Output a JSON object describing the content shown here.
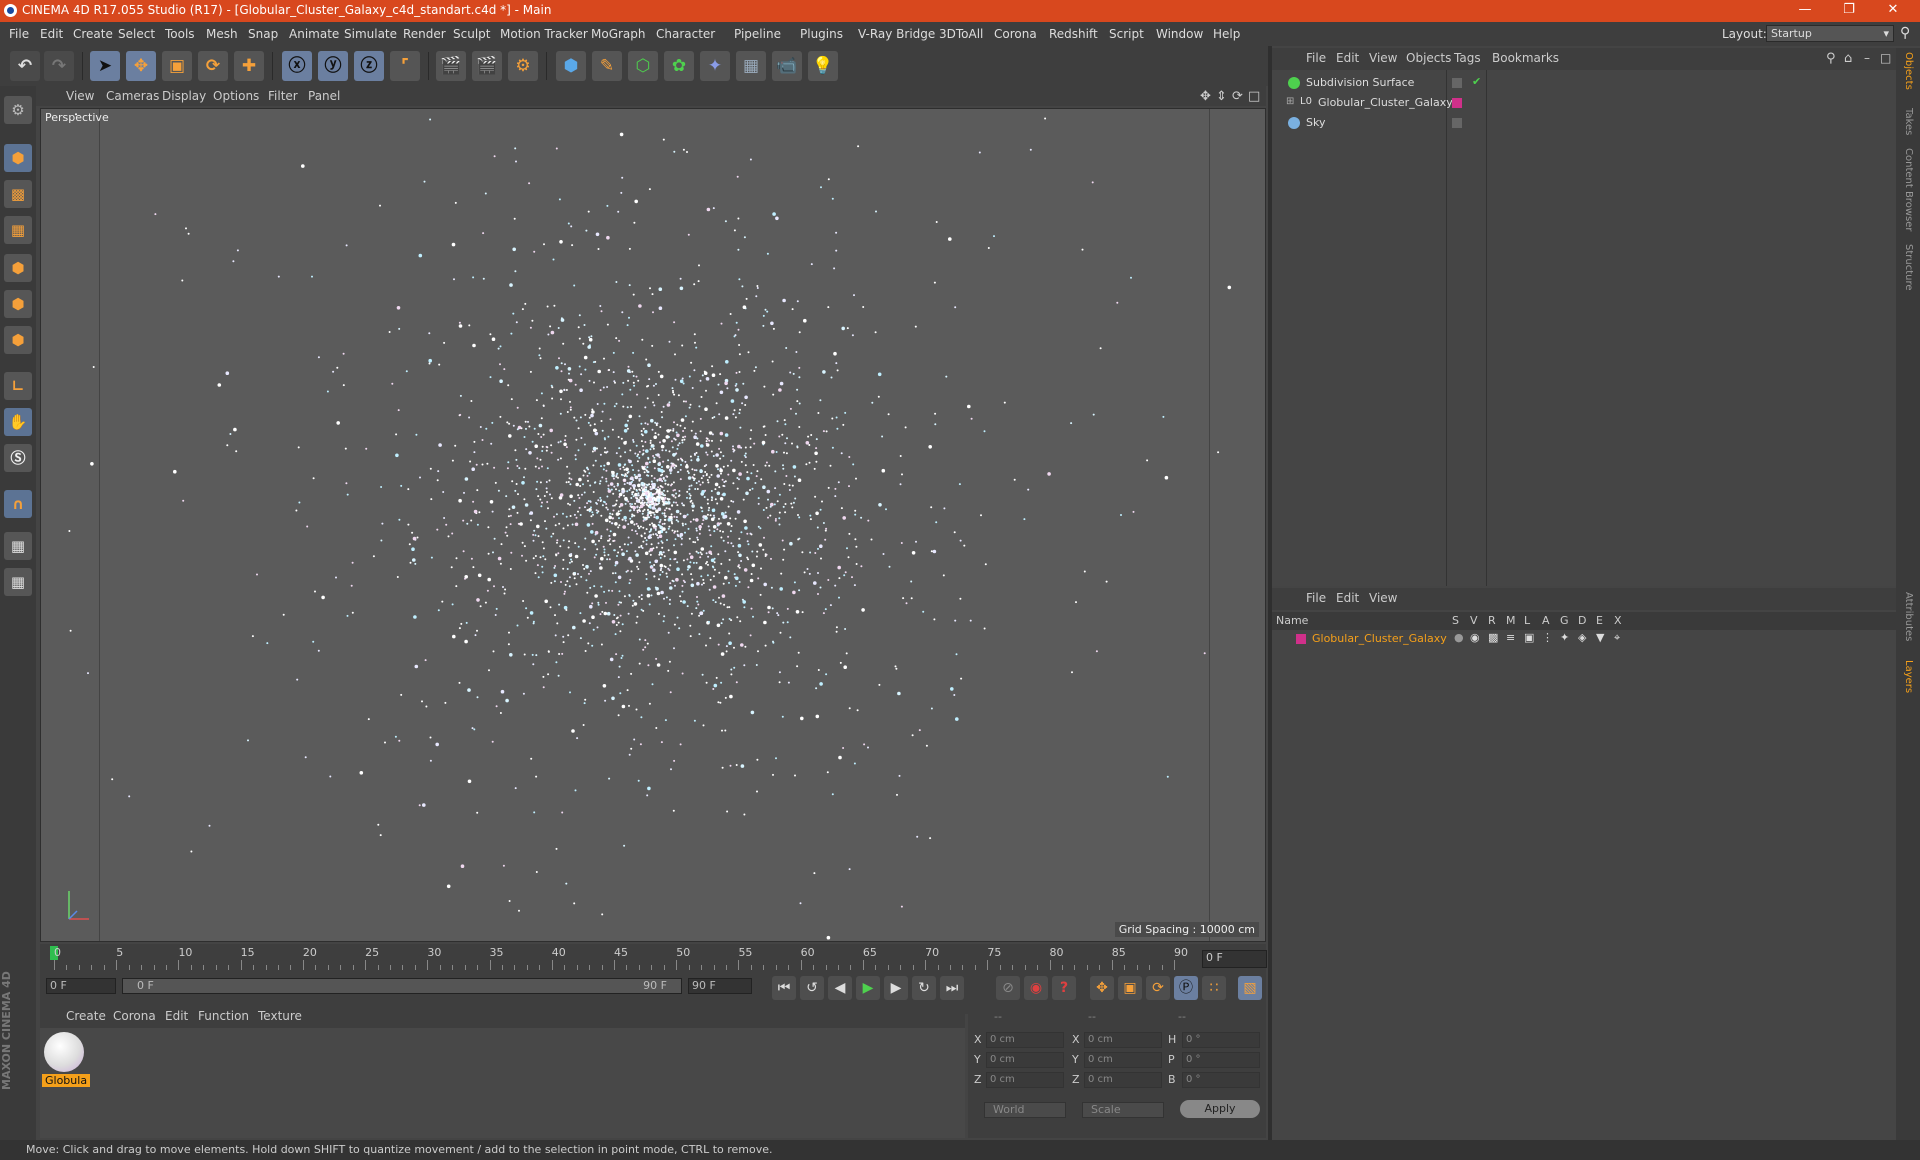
{
  "window": {
    "title": "CINEMA 4D R17.055 Studio (R17) - [Globular_Cluster_Galaxy_c4d_standart.c4d *] - Main",
    "layout_label": "Layout:",
    "layout_value": "Startup"
  },
  "menu": [
    "File",
    "Edit",
    "Create",
    "Select",
    "Tools",
    "Mesh",
    "Snap",
    "Animate",
    "Simulate",
    "Render",
    "Sculpt",
    "Motion Tracker",
    "MoGraph",
    "Character",
    "Pipeline",
    "Plugins",
    "V-Ray Bridge",
    "3DToAll",
    "Corona",
    "Redshift",
    "Script",
    "Window",
    "Help"
  ],
  "viewport": {
    "menu": [
      "View",
      "Cameras",
      "Display",
      "Options",
      "Filter",
      "Panel"
    ],
    "camera_label": "Perspective",
    "grid_spacing": "Grid Spacing : 10000 cm"
  },
  "timeline": {
    "ticks": [
      "0",
      "5",
      "10",
      "15",
      "20",
      "25",
      "30",
      "35",
      "40",
      "45",
      "50",
      "55",
      "60",
      "65",
      "70",
      "75",
      "80",
      "85",
      "90"
    ],
    "current_frame": "0 F",
    "start_field": "0 F",
    "range_start": "0 F",
    "range_end": "90 F",
    "end_field": "90 F"
  },
  "materials": {
    "menu": [
      "Create",
      "Corona",
      "Edit",
      "Function",
      "Texture"
    ],
    "item_name": "Globula"
  },
  "coordinates": {
    "header": [
      "--",
      "--",
      "--"
    ],
    "rows": [
      {
        "l1": "X",
        "v1": "0 cm",
        "l2": "X",
        "v2": "0 cm",
        "l3": "H",
        "v3": "0 °"
      },
      {
        "l1": "Y",
        "v1": "0 cm",
        "l2": "Y",
        "v2": "0 cm",
        "l3": "P",
        "v3": "0 °"
      },
      {
        "l1": "Z",
        "v1": "0 cm",
        "l2": "Z",
        "v2": "0 cm",
        "l3": "B",
        "v3": "0 °"
      }
    ],
    "space": "World",
    "mode": "Scale",
    "apply": "Apply"
  },
  "objects": {
    "menu": [
      "File",
      "Edit",
      "View",
      "Objects",
      "Tags",
      "Bookmarks"
    ],
    "items": [
      "Subdivision Surface",
      "Globular_Cluster_Galaxy",
      "Sky"
    ]
  },
  "layers": {
    "menu": [
      "File",
      "Edit",
      "View"
    ],
    "columns": [
      "Name",
      "S",
      "V",
      "R",
      "M",
      "L",
      "A",
      "G",
      "D",
      "E",
      "X"
    ],
    "items": [
      "Globular_Cluster_Galaxy"
    ]
  },
  "side_tabs": [
    "Objects",
    "Takes",
    "Content Browser",
    "Structure",
    "Attributes",
    "Layers"
  ],
  "status": "Move: Click and drag to move elements. Hold down SHIFT to quantize movement / add to the selection in point mode, CTRL to remove.",
  "colors": {
    "accent": "#d8481e",
    "selection": "#f5a01a",
    "layer": "#d0308a"
  }
}
